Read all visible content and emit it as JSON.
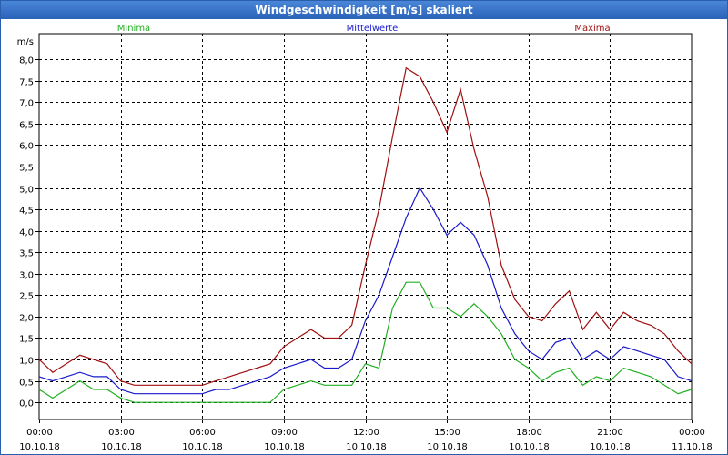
{
  "window": {
    "title": "Windgeschwindigkeit [m/s] skaliert"
  },
  "chart_data": {
    "type": "line",
    "title": "Windgeschwindigkeit [m/s] skaliert",
    "ylabel": "m/s",
    "xlabel": "",
    "ylim": [
      -0.4,
      8.6
    ],
    "xlim": [
      0,
      24
    ],
    "grid": true,
    "legend_position": "top",
    "y_ticks": [
      "0,0",
      "0,5",
      "1,0",
      "1,5",
      "2,0",
      "2,5",
      "3,0",
      "3,5",
      "4,0",
      "4,5",
      "5,0",
      "5,5",
      "6,0",
      "6,5",
      "7,0",
      "7,5",
      "8,0"
    ],
    "y_tick_values": [
      0,
      0.5,
      1,
      1.5,
      2,
      2.5,
      3,
      3.5,
      4,
      4.5,
      5,
      5.5,
      6,
      6.5,
      7,
      7.5,
      8
    ],
    "x_tick_values": [
      0,
      3,
      6,
      9,
      12,
      15,
      18,
      21,
      24
    ],
    "x_ticks": [
      {
        "time": "00:00",
        "date": "10.10.18"
      },
      {
        "time": "03:00",
        "date": "10.10.18"
      },
      {
        "time": "06:00",
        "date": "10.10.18"
      },
      {
        "time": "09:00",
        "date": "10.10.18"
      },
      {
        "time": "12:00",
        "date": "10.10.18"
      },
      {
        "time": "15:00",
        "date": "10.10.18"
      },
      {
        "time": "18:00",
        "date": "10.10.18"
      },
      {
        "time": "21:00",
        "date": "10.10.18"
      },
      {
        "time": "00:00",
        "date": "11.10.18"
      }
    ],
    "x": [
      0,
      0.5,
      1,
      1.5,
      2,
      2.5,
      3,
      3.5,
      4,
      4.5,
      5,
      5.5,
      6,
      6.5,
      7,
      7.5,
      8,
      8.5,
      9,
      9.5,
      10,
      10.5,
      11,
      11.5,
      12,
      12.5,
      13,
      13.5,
      14,
      14.5,
      15,
      15.5,
      16,
      16.5,
      17,
      17.5,
      18,
      18.5,
      19,
      19.5,
      20,
      20.5,
      21,
      21.5,
      22,
      22.5,
      23,
      23.5,
      24
    ],
    "series": [
      {
        "name": "Minima",
        "color": "#22b022",
        "values": [
          0.3,
          0.1,
          0.3,
          0.5,
          0.3,
          0.3,
          0.1,
          0.0,
          0.0,
          0.0,
          0.0,
          0.0,
          0.0,
          0.0,
          0.0,
          0.0,
          0.0,
          0.0,
          0.3,
          0.4,
          0.5,
          0.4,
          0.4,
          0.4,
          0.9,
          0.8,
          2.2,
          2.8,
          2.8,
          2.2,
          2.2,
          2.0,
          2.3,
          2.0,
          1.6,
          1.0,
          0.8,
          0.5,
          0.7,
          0.8,
          0.4,
          0.6,
          0.5,
          0.8,
          0.7,
          0.6,
          0.4,
          0.2,
          0.3
        ]
      },
      {
        "name": "Mittelwerte",
        "color": "#1a1acc",
        "values": [
          0.6,
          0.5,
          0.6,
          0.7,
          0.6,
          0.6,
          0.3,
          0.2,
          0.2,
          0.2,
          0.2,
          0.2,
          0.2,
          0.3,
          0.3,
          0.4,
          0.5,
          0.6,
          0.8,
          0.9,
          1.0,
          0.8,
          0.8,
          1.0,
          1.9,
          2.5,
          3.4,
          4.3,
          5.0,
          4.5,
          3.9,
          4.2,
          3.9,
          3.2,
          2.2,
          1.6,
          1.2,
          1.0,
          1.4,
          1.5,
          1.0,
          1.2,
          1.0,
          1.3,
          1.2,
          1.1,
          1.0,
          0.6,
          0.5
        ]
      },
      {
        "name": "Maxima",
        "color": "#a01010",
        "values": [
          1.0,
          0.7,
          0.9,
          1.1,
          1.0,
          0.9,
          0.5,
          0.4,
          0.4,
          0.4,
          0.4,
          0.4,
          0.4,
          0.5,
          0.6,
          0.7,
          0.8,
          0.9,
          1.3,
          1.5,
          1.7,
          1.5,
          1.5,
          1.8,
          3.2,
          4.5,
          6.2,
          7.8,
          7.6,
          7.0,
          6.3,
          7.3,
          5.9,
          4.8,
          3.2,
          2.4,
          2.0,
          1.9,
          2.3,
          2.6,
          1.7,
          2.1,
          1.7,
          2.1,
          1.9,
          1.8,
          1.6,
          1.2,
          0.9
        ]
      }
    ]
  }
}
